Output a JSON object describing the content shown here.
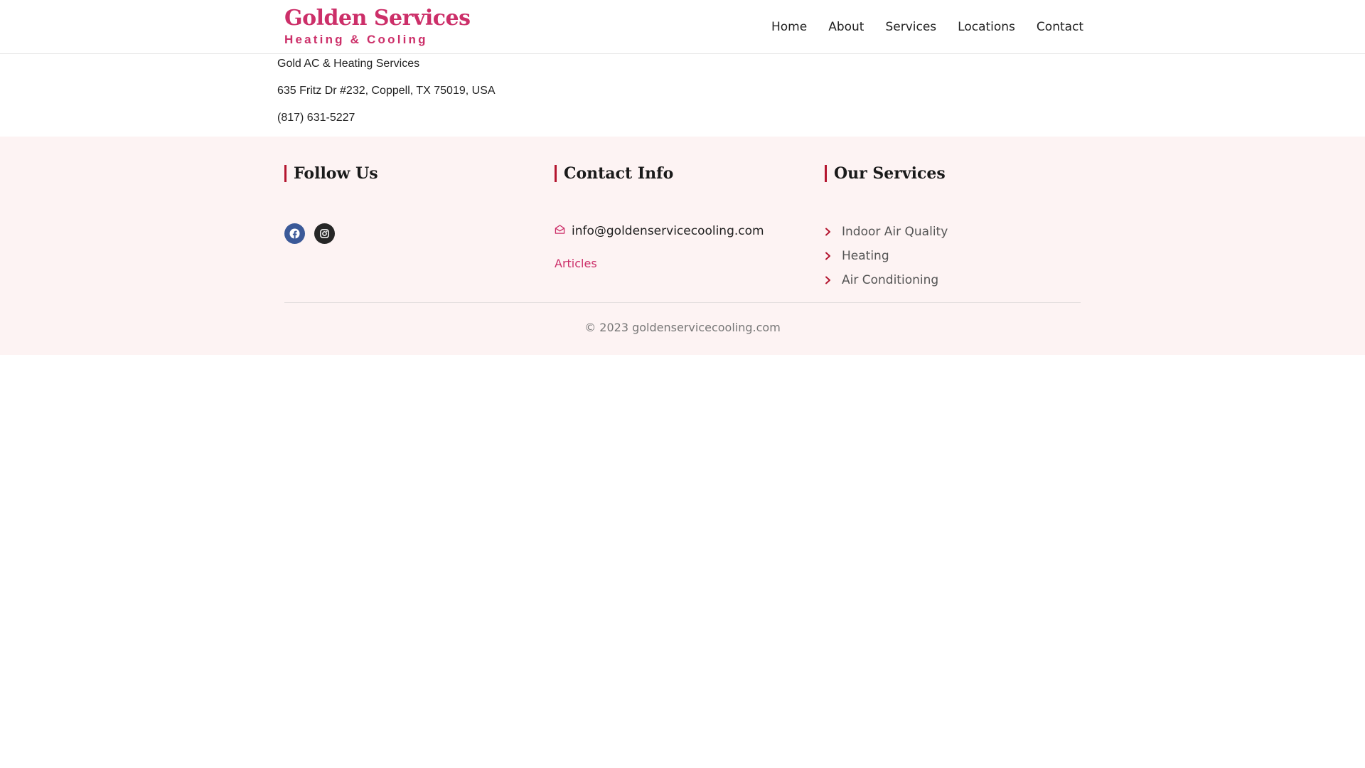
{
  "colors": {
    "brand": "#cc2f69",
    "accent_bar": "#b4152f",
    "footer_bg": "#fdf3f3",
    "facebook_bg": "#3b5998",
    "instagram_bg": "#262626",
    "chevron": "#b4152f"
  },
  "header": {
    "logo_title": "Golden Services",
    "logo_subtitle": "Heating & Cooling",
    "nav": [
      {
        "label": "Home"
      },
      {
        "label": "About"
      },
      {
        "label": "Services"
      },
      {
        "label": "Locations"
      },
      {
        "label": "Contact"
      }
    ]
  },
  "business": {
    "name": "Gold AC & Heating Services",
    "address": "635 Fritz Dr #232, Coppell, TX 75019, USA",
    "phone": "(817) 631-5227"
  },
  "footer": {
    "follow": {
      "heading": "Follow Us",
      "socials": [
        {
          "icon": "facebook-icon"
        },
        {
          "icon": "instagram-icon"
        }
      ]
    },
    "contact": {
      "heading": "Contact Info",
      "email_icon": "envelope-open-icon",
      "email": "info@goldenservicecooling.com",
      "articles_label": "Articles"
    },
    "services": {
      "heading": "Our Services",
      "item_icon": "chevron-right-icon",
      "items": [
        {
          "label": "Indoor Air Quality"
        },
        {
          "label": "Heating"
        },
        {
          "label": "Air Conditioning"
        }
      ]
    },
    "copyright": "© 2023 goldenservicecooling.com"
  }
}
